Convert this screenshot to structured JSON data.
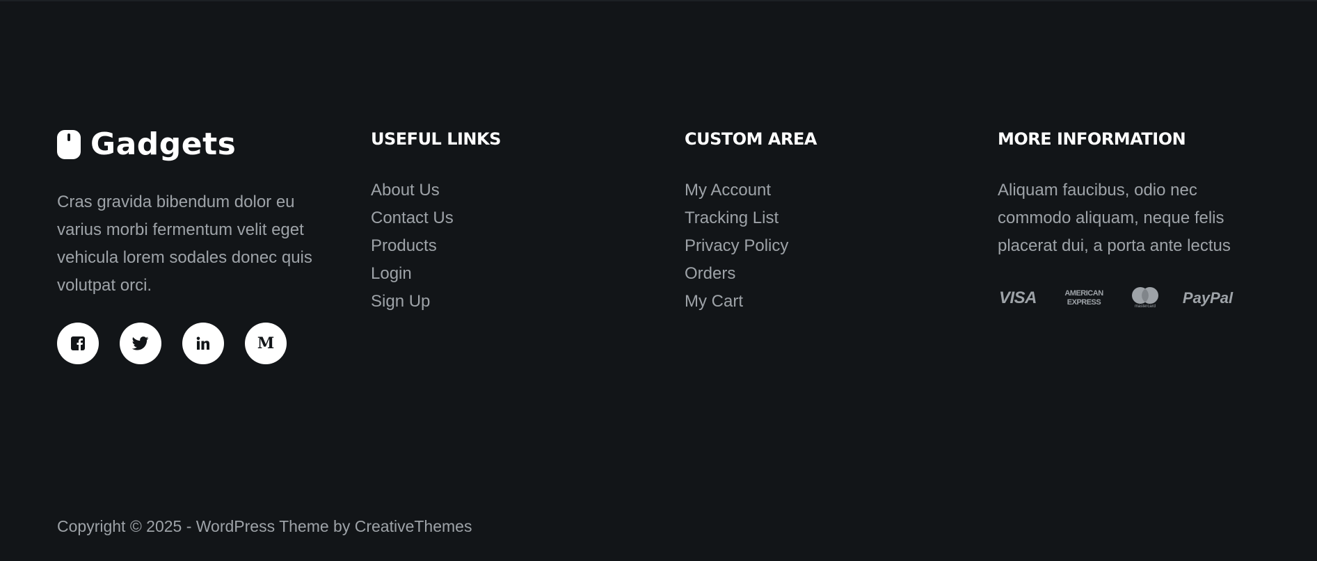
{
  "brand": {
    "logo_text": "Gadgets",
    "description": "Cras gravida bibendum dolor eu varius morbi fermentum velit eget vehicula lorem sodales donec quis volutpat orci.",
    "socials": [
      {
        "name": "facebook",
        "icon": "facebook-icon"
      },
      {
        "name": "twitter",
        "icon": "twitter-icon"
      },
      {
        "name": "linkedin",
        "icon": "linkedin-icon"
      },
      {
        "name": "medium",
        "icon": "medium-icon",
        "glyph": "M"
      }
    ]
  },
  "useful_links": {
    "title": "USEFUL LINKS",
    "items": [
      "About Us",
      "Contact Us",
      "Products",
      "Login",
      "Sign Up"
    ]
  },
  "custom_area": {
    "title": "CUSTOM AREA",
    "items": [
      "My Account",
      "Tracking List",
      "Privacy Policy",
      "Orders",
      "My Cart"
    ]
  },
  "more_information": {
    "title": "MORE INFORMATION",
    "description": "Aliquam faucibus, odio nec commodo aliquam, neque felis placerat dui, a porta ante lectus",
    "payments": {
      "visa": "VISA",
      "amex_line1": "AMERICAN",
      "amex_line2": "EXPRESS",
      "mastercard": "mastercard",
      "paypal": "PayPal"
    }
  },
  "footer": {
    "copyright": "Copyright © 2025 - WordPress Theme by CreativeThemes"
  },
  "colors": {
    "background": "#121518",
    "heading": "#ffffff",
    "muted_text": "#9ea3a8",
    "social_bg": "#ffffff"
  }
}
